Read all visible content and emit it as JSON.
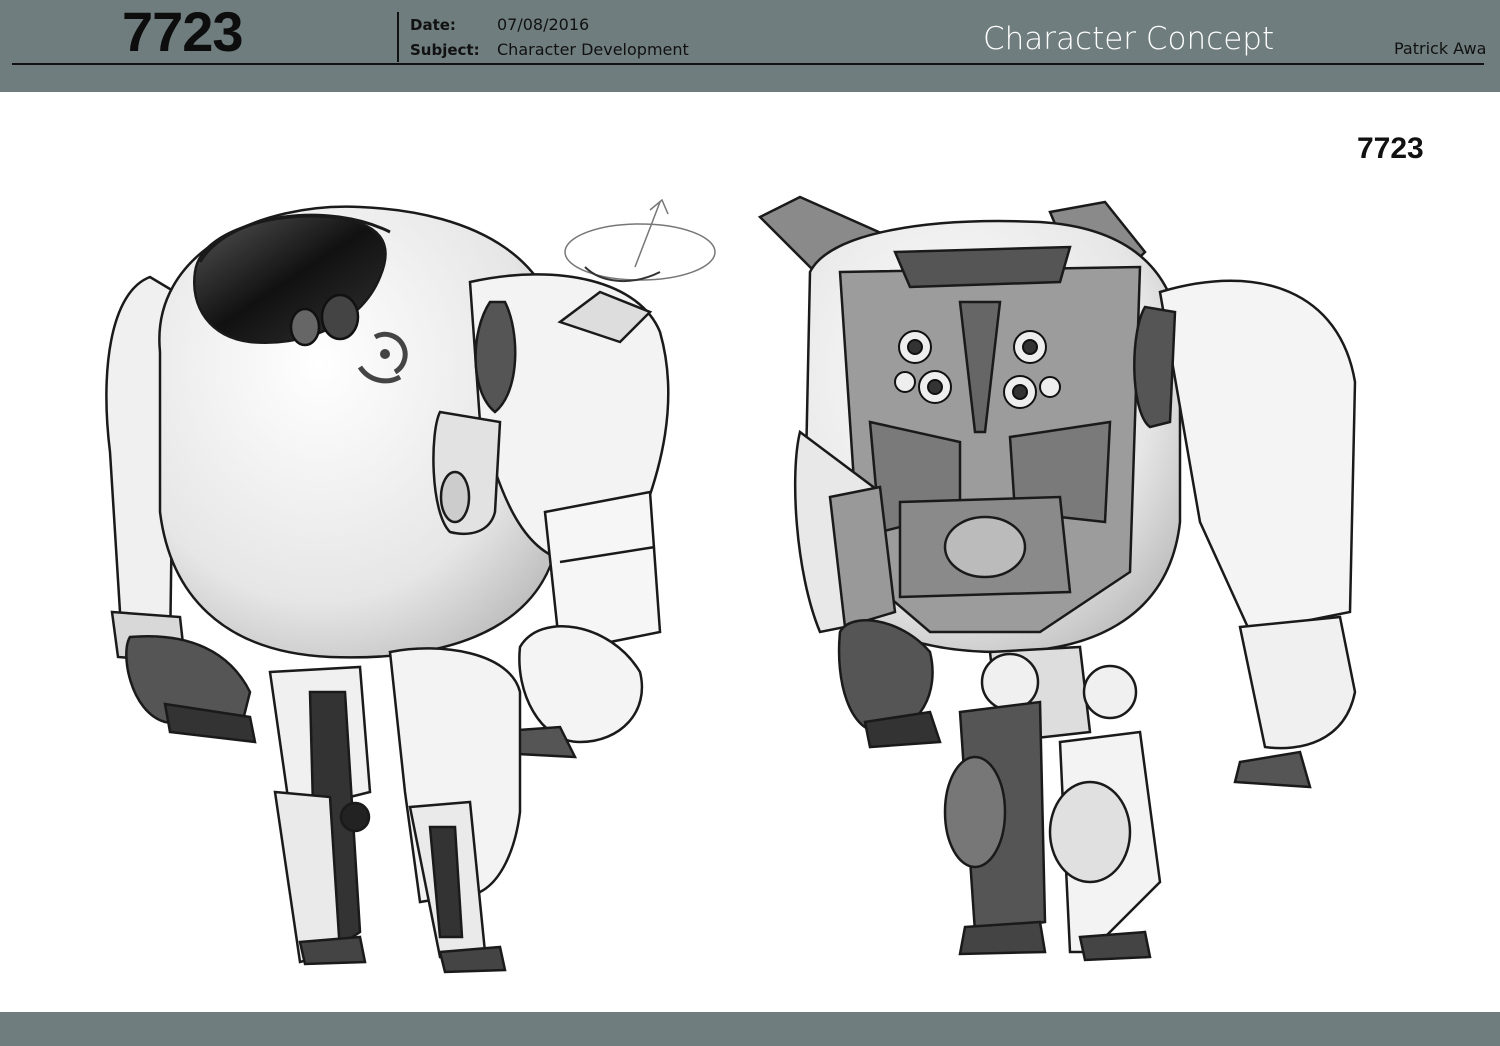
{
  "header": {
    "code": "7723",
    "date_label": "Date:",
    "date_value": "07/08/2016",
    "subject_label": "Subject:",
    "subject_value": "Character Development",
    "title": "Character Concept",
    "author": "Patrick Awa"
  },
  "sheet": {
    "character_label": "7723"
  },
  "colors": {
    "bar": "#6f7d7e",
    "paper": "#ffffff",
    "ink": "#111111"
  }
}
